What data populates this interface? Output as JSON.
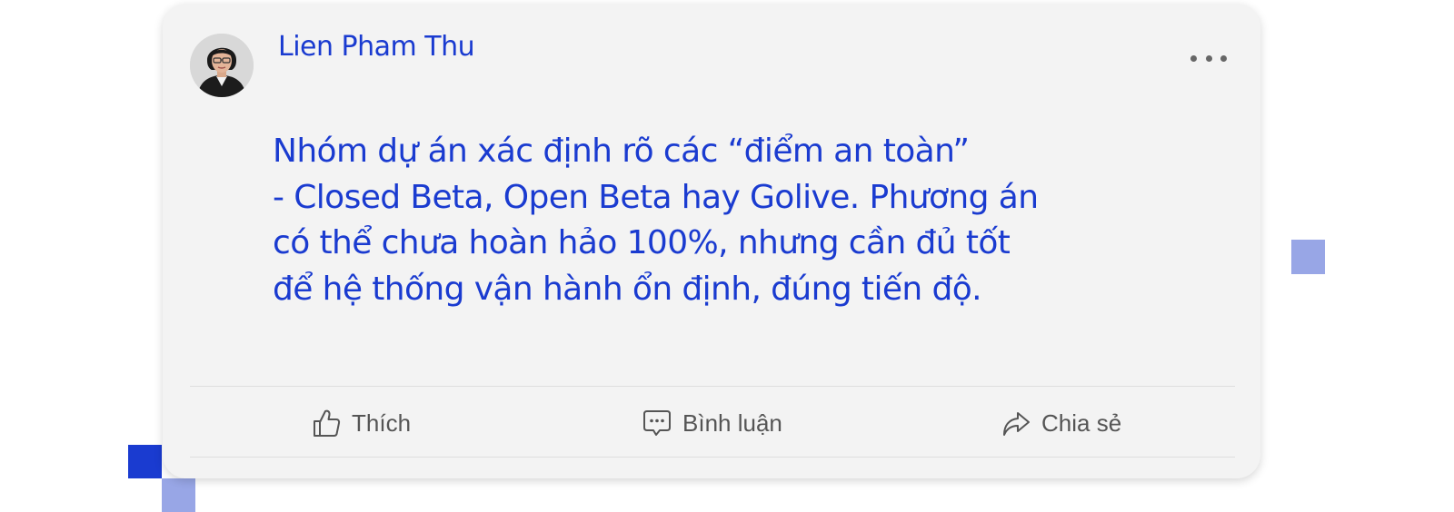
{
  "post": {
    "author": {
      "name": "Lien Pham Thu",
      "avatar_icon": "user-avatar-photo"
    },
    "menu_icon": "more-horizontal-icon",
    "text_lines": [
      "Nhóm dự án xác định rõ các “điểm an toàn”",
      "- Closed Beta, Open Beta hay Golive. Phương án",
      "có thể chưa hoàn hảo 100%, nhưng cần đủ tốt",
      "để hệ thống vận hành ổn định, đúng tiến độ."
    ]
  },
  "actions": {
    "like": {
      "label": "Thích",
      "icon": "thumbs-up-icon"
    },
    "comment": {
      "label": "Bình luận",
      "icon": "comment-icon"
    },
    "share": {
      "label": "Chia sẻ",
      "icon": "share-arrow-icon"
    }
  },
  "colors": {
    "accent": "#1a3bd0",
    "accent_light": "#98a6e6",
    "card_background": "#f3f3f3",
    "action_text": "#555555"
  }
}
